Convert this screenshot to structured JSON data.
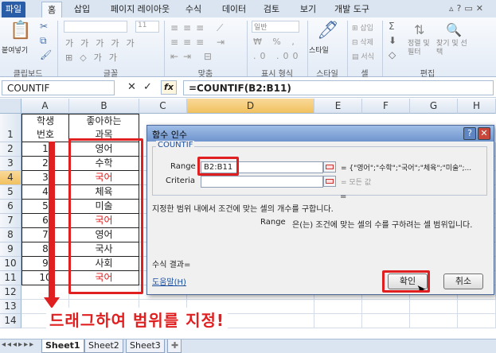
{
  "ribbon": {
    "tabs": [
      "파일",
      "홈",
      "삽입",
      "페이지 레이아웃",
      "수식",
      "데이터",
      "검토",
      "보기",
      "개발 도구"
    ],
    "groups": [
      "클립보드",
      "글꼴",
      "맞춤",
      "표시 형식",
      "스타일",
      "셀",
      "편집"
    ],
    "paste": "붙여넣기",
    "font_size": "11",
    "number_format": "일반",
    "style": "스타일",
    "cell_insert": "삽입",
    "cell_delete": "삭제",
    "cell_format": "서식",
    "sort_filter": "정렬 및 필터",
    "find_select": "찾기 및 선택"
  },
  "formula_bar": {
    "name_box": "COUNTIF",
    "fx": "fx",
    "formula": "=COUNTIF(B2:B11)"
  },
  "sheet": {
    "columns": [
      "A",
      "B",
      "C",
      "D",
      "E",
      "F",
      "G",
      "H"
    ],
    "rows": [
      "1",
      "2",
      "3",
      "4",
      "5",
      "6",
      "7",
      "8",
      "9",
      "10",
      "11",
      "12",
      "13",
      "14"
    ],
    "header_a1": "학생",
    "header_a2": "번호",
    "header_b1": "좋아하는",
    "header_b2": "과목",
    "numbers": [
      "1",
      "2",
      "3",
      "4",
      "5",
      "6",
      "7",
      "8",
      "9",
      "10"
    ],
    "subjects": [
      "영어",
      "수학",
      "국어",
      "체육",
      "미술",
      "국어",
      "영어",
      "국사",
      "사회",
      "국어"
    ],
    "red_rows": [
      2,
      5,
      9
    ],
    "annotation": "드래그하여 범위를 지정!",
    "tabs": [
      "Sheet1",
      "Sheet2",
      "Sheet3"
    ]
  },
  "dialog": {
    "title": "함수 인수",
    "help_btn": "?",
    "close_btn": "✕",
    "fn_name": "COUNTIF",
    "range_label": "Range",
    "range_value": "B2:B11",
    "range_result": "= {\"영어\";\"수학\";\"국어\";\"체육\";\"미술\";...",
    "criteria_label": "Criteria",
    "criteria_result": "= 모든 값",
    "eq": "=",
    "description": "지정한 범위 내에서 조건에 맞는 셀의 개수를 구합니다.",
    "arg_name": "Range",
    "arg_desc": "은(는) 조건에 맞는 셀의 수를 구하려는 셀 범위입니다.",
    "result_label": "수식 결과=",
    "help_link": "도움말(H)",
    "ok": "확인",
    "cancel": "취소"
  },
  "colors": {
    "accent": "#e02020",
    "title_blue": "#6f95ce"
  }
}
